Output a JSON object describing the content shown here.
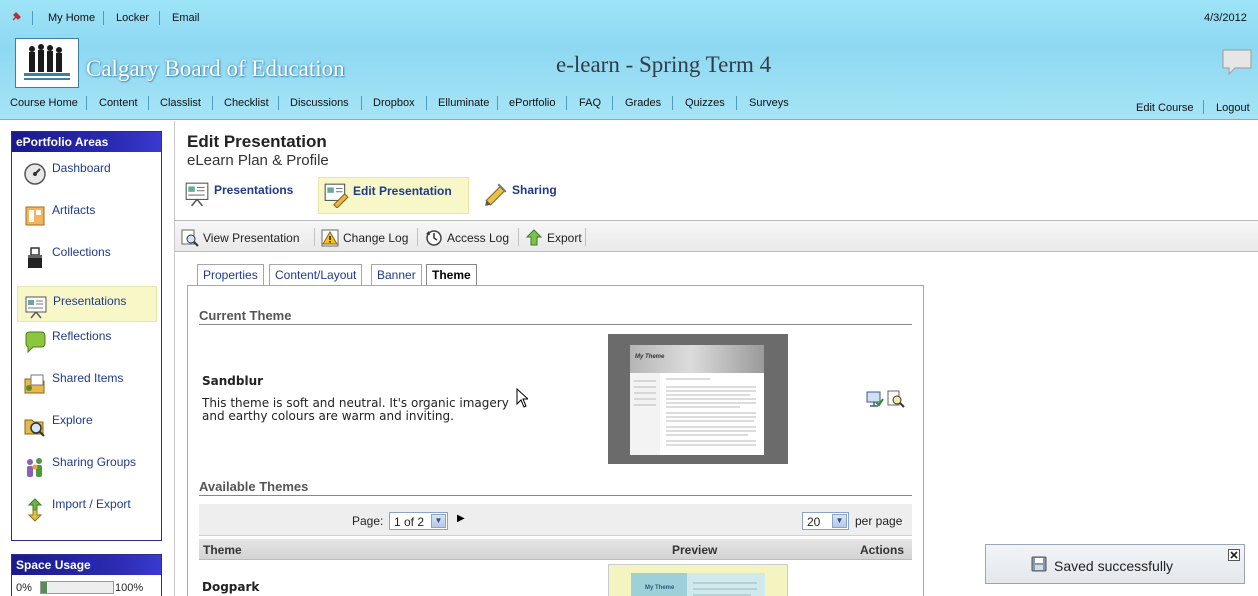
{
  "header": {
    "top_links": [
      "My Home",
      "Locker",
      "Email"
    ],
    "date": "4/3/2012",
    "org_name": "Calgary Board of Education",
    "course_title": "e-learn - Spring Term 4",
    "nav": [
      "Course Home",
      "Content",
      "Classlist",
      "Checklist",
      "Discussions",
      "Dropbox",
      "Elluminate",
      "ePortfolio",
      "FAQ",
      "Grades",
      "Quizzes",
      "Surveys"
    ],
    "edit_course": "Edit Course",
    "logout": "Logout"
  },
  "sidebar": {
    "title": "ePortfolio Areas",
    "items": [
      {
        "label": "Dashboard",
        "icon": "dashboard-icon"
      },
      {
        "label": "Artifacts",
        "icon": "artifacts-icon"
      },
      {
        "label": "Collections",
        "icon": "collections-icon"
      },
      {
        "label": "Presentations",
        "icon": "presentations-icon",
        "selected": true
      },
      {
        "label": "Reflections",
        "icon": "reflections-icon"
      },
      {
        "label": "Shared Items",
        "icon": "shared-items-icon"
      },
      {
        "label": "Explore",
        "icon": "explore-icon"
      },
      {
        "label": "Sharing Groups",
        "icon": "sharing-groups-icon"
      },
      {
        "label": "Import / Export",
        "icon": "import-export-icon"
      }
    ],
    "space_usage": {
      "title": "Space Usage",
      "min_label": "0%",
      "max_label": "100%",
      "used_fraction": 0.08
    }
  },
  "main": {
    "heading": "Edit Presentation",
    "subheading": "eLearn Plan & Profile",
    "tabs": [
      {
        "label": "Presentations",
        "icon": "presentations-icon"
      },
      {
        "label": "Edit Presentation",
        "icon": "edit-presentation-icon",
        "active": true
      },
      {
        "label": "Sharing",
        "icon": "sharing-icon"
      }
    ],
    "toolbar": [
      {
        "label": "View Presentation",
        "icon": "view-presentation-icon"
      },
      {
        "label": "Change Log",
        "icon": "change-log-icon"
      },
      {
        "label": "Access Log",
        "icon": "access-log-icon"
      },
      {
        "label": "Export",
        "icon": "export-icon"
      }
    ],
    "subtabs": [
      "Properties",
      "Content/Layout",
      "Banner",
      "Theme"
    ],
    "active_subtab": "Theme",
    "current_theme": {
      "section_title": "Current Theme",
      "name": "Sandblur",
      "description": "This theme is soft and neutral. It's organic imagery and earthy colours are warm and inviting.",
      "preview_banner_text": "My Theme"
    },
    "available_themes": {
      "section_title": "Available Themes",
      "page_label": "Page:",
      "page_value": "1 of 2",
      "per_page_value": "20",
      "per_page_label": "per page",
      "columns": [
        "Theme",
        "Preview",
        "Actions"
      ],
      "rows": [
        {
          "name": "Dogpark",
          "preview_banner_text": "My Theme"
        }
      ]
    }
  },
  "toast": {
    "message": "Saved successfully"
  },
  "colors": {
    "header_bg": "#9ee4f8",
    "sidebar_title_bg": "#1a1a8c",
    "selected_bg": "#f7f7c8",
    "link_blue": "#1f3a8a"
  }
}
